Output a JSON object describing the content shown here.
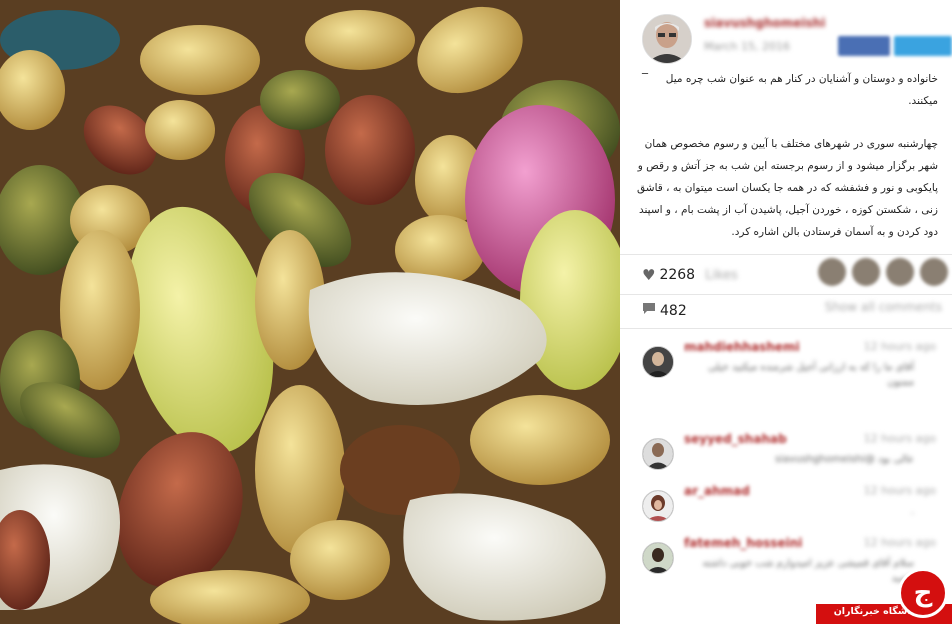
{
  "post": {
    "username": "siavushghomeishi",
    "date": "March 15, 2016",
    "dash": "_",
    "caption_1": "خانواده و دوستان و آشنایان در کنار هم به عنوان شب چره میل میکنند.",
    "caption_2": "چهارشنبه سوری در شهرهای مختلف با آیین و رسوم مخصوص همان شهر برگزار میشود و از رسوم برجسته این شب به جز آتش و رقص و پایکوبی و نور و فشفشه که در همه جا یکسان است میتوان به ، قاشق زنی ، شکستن کوزه ، خوردن آجیل، پاشیدن آب از پشت بام ، و اسپند دود کردن و به آسمان فرستادن بالن اشاره کرد.",
    "likes": "2268",
    "likes_label": "Likes",
    "comments_count": "482",
    "comments_label": "Show all comments",
    "heart_icon": "♥",
    "comment_icon": "speech-bubble"
  },
  "comments": [
    {
      "name": "mahdiehhashemi",
      "time": "12 hours ago",
      "text": "آقای ما را که به ارزانی آجیل شرمنده میکنید خیلی ممنون"
    },
    {
      "name": "seyyed_shahab",
      "time": "12 hours ago",
      "text": "عالی بود @siavushghomeishi"
    },
    {
      "name": "ar_ahmad",
      "time": "12 hours ago",
      "text": "."
    },
    {
      "name": "fatemeh_hosseini",
      "time": "12 hours ago",
      "text": "سلام آقای قمیشی عزیز امیدوارم شب خوبی داشته باشید"
    }
  ],
  "watermark": {
    "text": "باشگاه خبرنگاران",
    "symbol": "ج"
  },
  "colors": {
    "brand_red": "#d40f0f",
    "username_red": "#b03030"
  }
}
